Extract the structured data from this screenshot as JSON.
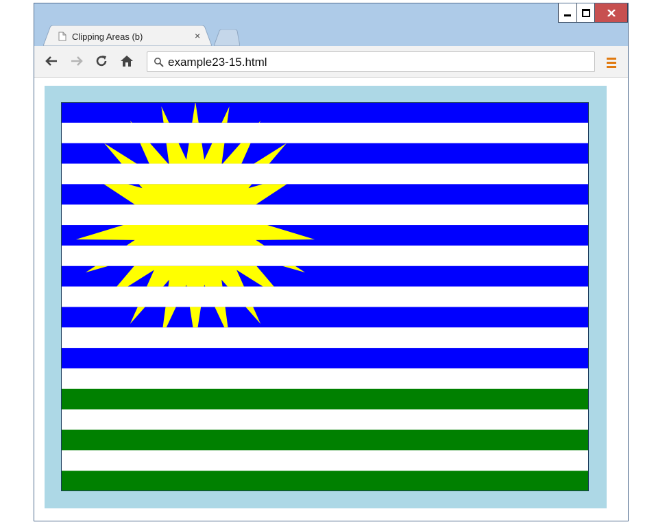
{
  "browser": {
    "tab": {
      "title": "Clipping Areas (b)",
      "close_glyph": "×",
      "icon": "page-icon"
    },
    "window_controls": [
      "minimize",
      "maximize",
      "close"
    ],
    "nav": {
      "back": "back-arrow-icon",
      "forward": "forward-arrow-icon",
      "reload": "reload-icon",
      "home": "home-icon"
    },
    "address_bar": {
      "url": "example23-15.html",
      "icon": "search-icon"
    },
    "menu": "hamburger-menu-icon"
  },
  "canvas": {
    "frame_color": "#add8e6",
    "stripe_colors": [
      "#0000ff",
      "#ffffff",
      "#0000ff",
      "#ffffff",
      "#0000ff",
      "#ffffff",
      "#0000ff",
      "#ffffff",
      "#0000ff",
      "#ffffff",
      "#0000ff",
      "#ffffff",
      "#0000ff",
      "#ffffff",
      "#008000",
      "#ffffff",
      "#008000",
      "#ffffff",
      "#008000"
    ],
    "sun_color": "#ffff00",
    "border_color": "#1a3a5a"
  }
}
